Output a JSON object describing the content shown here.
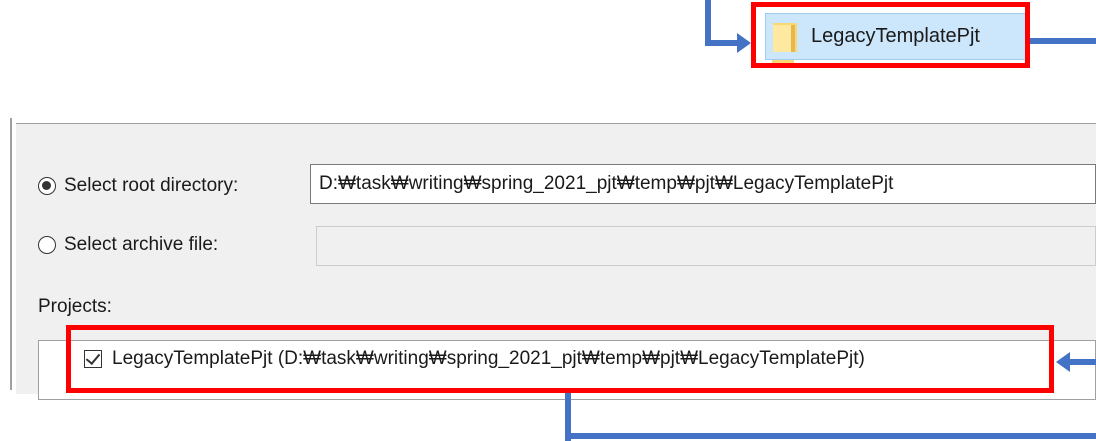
{
  "file_explorer": {
    "folder_label": "LegacyTemplatePjt"
  },
  "import_dialog": {
    "root_directory": {
      "label": "Select root directory:",
      "value": "D:₩task₩writing₩spring_2021_pjt₩temp₩pjt₩LegacyTemplatePjt",
      "selected": true
    },
    "archive_file": {
      "label": "Select archive file:",
      "value": "",
      "selected": false
    },
    "projects_label": "Projects:",
    "projects": [
      {
        "label": "LegacyTemplatePjt (D:₩task₩writing₩spring_2021_pjt₩temp₩pjt₩LegacyTemplatePjt)",
        "checked": true
      }
    ]
  },
  "annotations": {
    "highlight_color": "#ff0000",
    "arrow_color": "#4472c4"
  }
}
